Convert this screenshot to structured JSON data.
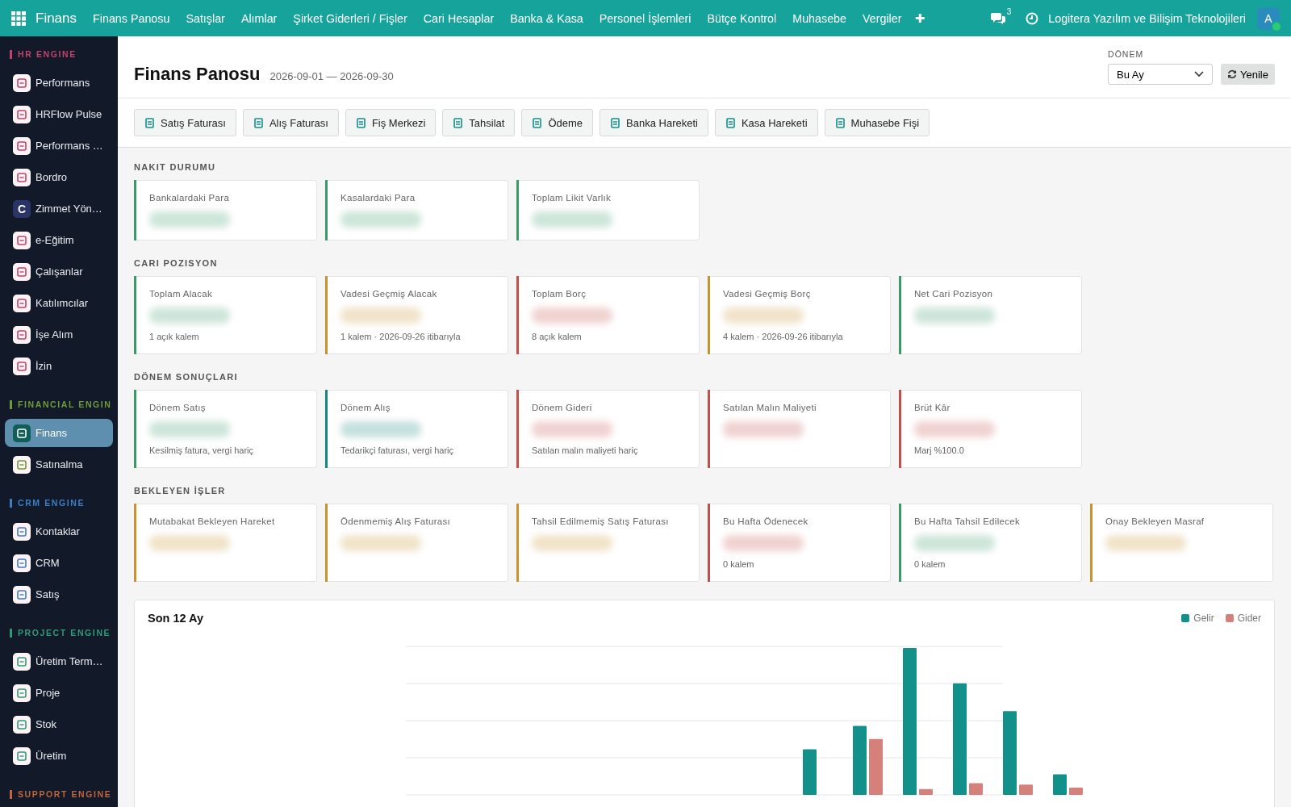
{
  "topbar": {
    "app": "Finans",
    "menu": [
      "Finans Panosu",
      "Satışlar",
      "Alımlar",
      "Şirket Giderleri / Fişler",
      "Cari Hesaplar",
      "Banka & Kasa",
      "Personel İşlemleri",
      "Bütçe Kontrol",
      "Muhasebe",
      "Vergiler"
    ],
    "add": "✚",
    "chat_count": "3",
    "company": "Logitera Yazılım ve Bilişim Teknolojileri",
    "avatar": "A"
  },
  "sidebar": {
    "sections": [
      {
        "title": "HR ENGINE",
        "color": "#c2416b",
        "items": [
          {
            "label": "Performans",
            "selected": false
          },
          {
            "label": "HRFlow Pulse",
            "selected": false
          },
          {
            "label": "Performans …",
            "selected": false
          },
          {
            "label": "Bordro",
            "selected": false
          },
          {
            "label": "Zimmet Yön…",
            "letter": "C",
            "selected": false
          },
          {
            "label": "e-Eğitim",
            "selected": false
          },
          {
            "label": "Çalışanlar",
            "selected": false
          },
          {
            "label": "Katılımcılar",
            "selected": false
          },
          {
            "label": "İşe Alım",
            "selected": false
          },
          {
            "label": "İzin",
            "selected": false
          }
        ]
      },
      {
        "title": "FINANCIAL ENGIN",
        "color": "#6f9a3a",
        "items": [
          {
            "label": "Finans",
            "selected": true
          },
          {
            "label": "Satınalma",
            "selected": false
          }
        ]
      },
      {
        "title": "CRM ENGINE",
        "color": "#3b7fc4",
        "items": [
          {
            "label": "Kontaklar",
            "selected": false
          },
          {
            "label": "CRM",
            "selected": false
          },
          {
            "label": "Satış",
            "selected": false
          }
        ]
      },
      {
        "title": "PROJECT ENGINE",
        "color": "#2f9a7a",
        "items": [
          {
            "label": "Üretim Term…",
            "selected": false
          },
          {
            "label": "Proje",
            "selected": false
          },
          {
            "label": "Stok",
            "selected": false
          },
          {
            "label": "Üretim",
            "selected": false
          }
        ]
      },
      {
        "title": "SUPPORT ENGINE",
        "color": "#c0643a"
      }
    ]
  },
  "header": {
    "title": "Finans Panosu",
    "range": "2026-09-01 — 2026-09-30",
    "period_label": "DÖNEM",
    "period_value": "Bu Ay",
    "refresh": "Yenile"
  },
  "actions": [
    "Satış Faturası",
    "Alış Faturası",
    "Fiş Merkezi",
    "Tahsilat",
    "Ödeme",
    "Banka Hareketi",
    "Kasa Hareketi",
    "Muhasebe Fişi"
  ],
  "sections": [
    {
      "title": "NAKIT DURUMU",
      "cards": [
        {
          "label": "Bankalardaki Para",
          "color": "#3a9a6a"
        },
        {
          "label": "Kasalardaki Para",
          "color": "#3a9a6a"
        },
        {
          "label": "Toplam Likit Varlık",
          "color": "#3a9a6a"
        }
      ]
    },
    {
      "title": "CARI POZISYON",
      "cards": [
        {
          "label": "Toplam Alacak",
          "color": "#3a9a6a",
          "note": "1 açık kalem"
        },
        {
          "label": "Vadesi Geçmiş Alacak",
          "color": "#c8922e",
          "note": "1 kalem · 2026-09-26 itibarıyla"
        },
        {
          "label": "Toplam Borç",
          "color": "#c2504a",
          "note": "8 açık kalem"
        },
        {
          "label": "Vadesi Geçmiş Borç",
          "color": "#c8922e",
          "note": "4 kalem · 2026-09-26 itibarıyla"
        },
        {
          "label": "Net Cari Pozisyon",
          "color": "#3a9a6a"
        }
      ]
    },
    {
      "title": "DÖNEM SONUÇLARI",
      "cards": [
        {
          "label": "Dönem Satış",
          "color": "#3a9a6a",
          "note": "Kesilmiş fatura, vergi hariç"
        },
        {
          "label": "Dönem Alış",
          "color": "#16877e",
          "note": "Tedarikçi faturası, vergi hariç"
        },
        {
          "label": "Dönem Gideri",
          "color": "#c2504a",
          "note": "Satılan malın maliyeti hariç"
        },
        {
          "label": "Satılan Malın Maliyeti",
          "color": "#c2504a"
        },
        {
          "label": "Brüt Kâr",
          "color": "#c2504a",
          "note": "Marj %100.0"
        }
      ]
    },
    {
      "title": "BEKLEYEN İŞLER",
      "cards": [
        {
          "label": "Mutabakat Bekleyen Hareket",
          "color": "#c8922e"
        },
        {
          "label": "Ödenmemiş Alış Faturası",
          "color": "#c8922e"
        },
        {
          "label": "Tahsil Edilmemiş Satış Faturası",
          "color": "#c8922e"
        },
        {
          "label": "Bu Hafta Ödenecek",
          "color": "#c2504a",
          "note": "0 kalem"
        },
        {
          "label": "Bu Hafta Tahsil Edilecek",
          "color": "#3a9a6a",
          "note": "0 kalem"
        },
        {
          "label": "Onay Bekleyen Masraf",
          "color": "#c8922e"
        }
      ]
    }
  ],
  "chart": {
    "title": "Son 12 Ay",
    "legend": [
      {
        "label": "Gelir",
        "color": "#12908a"
      },
      {
        "label": "Gider",
        "color": "#d5807a"
      }
    ]
  }
}
